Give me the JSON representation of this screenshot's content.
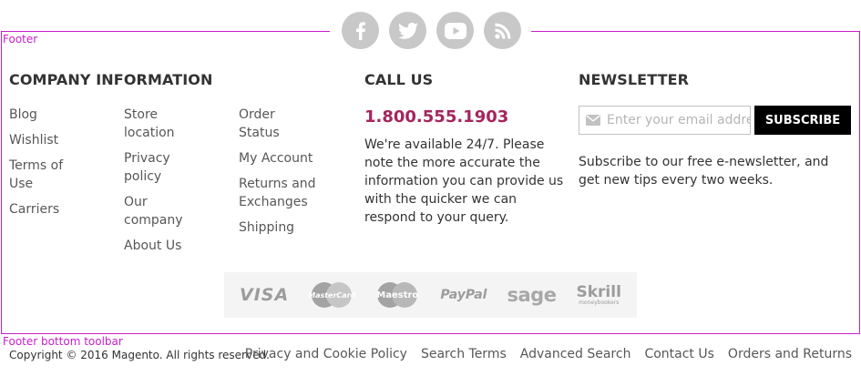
{
  "overlay": {
    "footer_label": "Footer",
    "toolbar_label": "Footer bottom toolbar",
    "color": "#c81ecf"
  },
  "socials": [
    "facebook-icon",
    "twitter-icon",
    "youtube-icon",
    "rss-icon"
  ],
  "company": {
    "title": "COMPANY INFORMATION",
    "col1": [
      "Blog",
      "Wishlist",
      "Terms of Use",
      "Carriers"
    ],
    "col2": [
      "Store location",
      "Privacy policy",
      "Our company",
      "About Us"
    ],
    "col3": [
      "Order Status",
      "My Account",
      "Returns and Exchanges",
      "Shipping"
    ]
  },
  "call": {
    "title": "CALL US",
    "phone": "1.800.555.1903",
    "text": "We're available 24/7. Please note the more accurate the information you can provide us with the quicker we can respond to your query."
  },
  "newsletter": {
    "title": "NEWSLETTER",
    "placeholder": "Enter your email address",
    "button": "SUBSCRIBE",
    "text": "Subscribe to our free e-newsletter, and get new tips every two weeks."
  },
  "payments": {
    "visa": "VISA",
    "mastercard": "MasterCard",
    "maestro": "Maestro",
    "paypal": "PayPal",
    "sage": "sage",
    "skrill": "Skrill",
    "skrill_sub": "moneybookers"
  },
  "bottom": {
    "copyright": "Copyright © 2016 Magento. All rights reserved.",
    "links": [
      "Privacy and Cookie Policy",
      "Search Terms",
      "Advanced Search",
      "Contact Us",
      "Orders and Returns"
    ]
  },
  "colors": {
    "accent": "#a5255c",
    "social": "#c8c8c8"
  }
}
